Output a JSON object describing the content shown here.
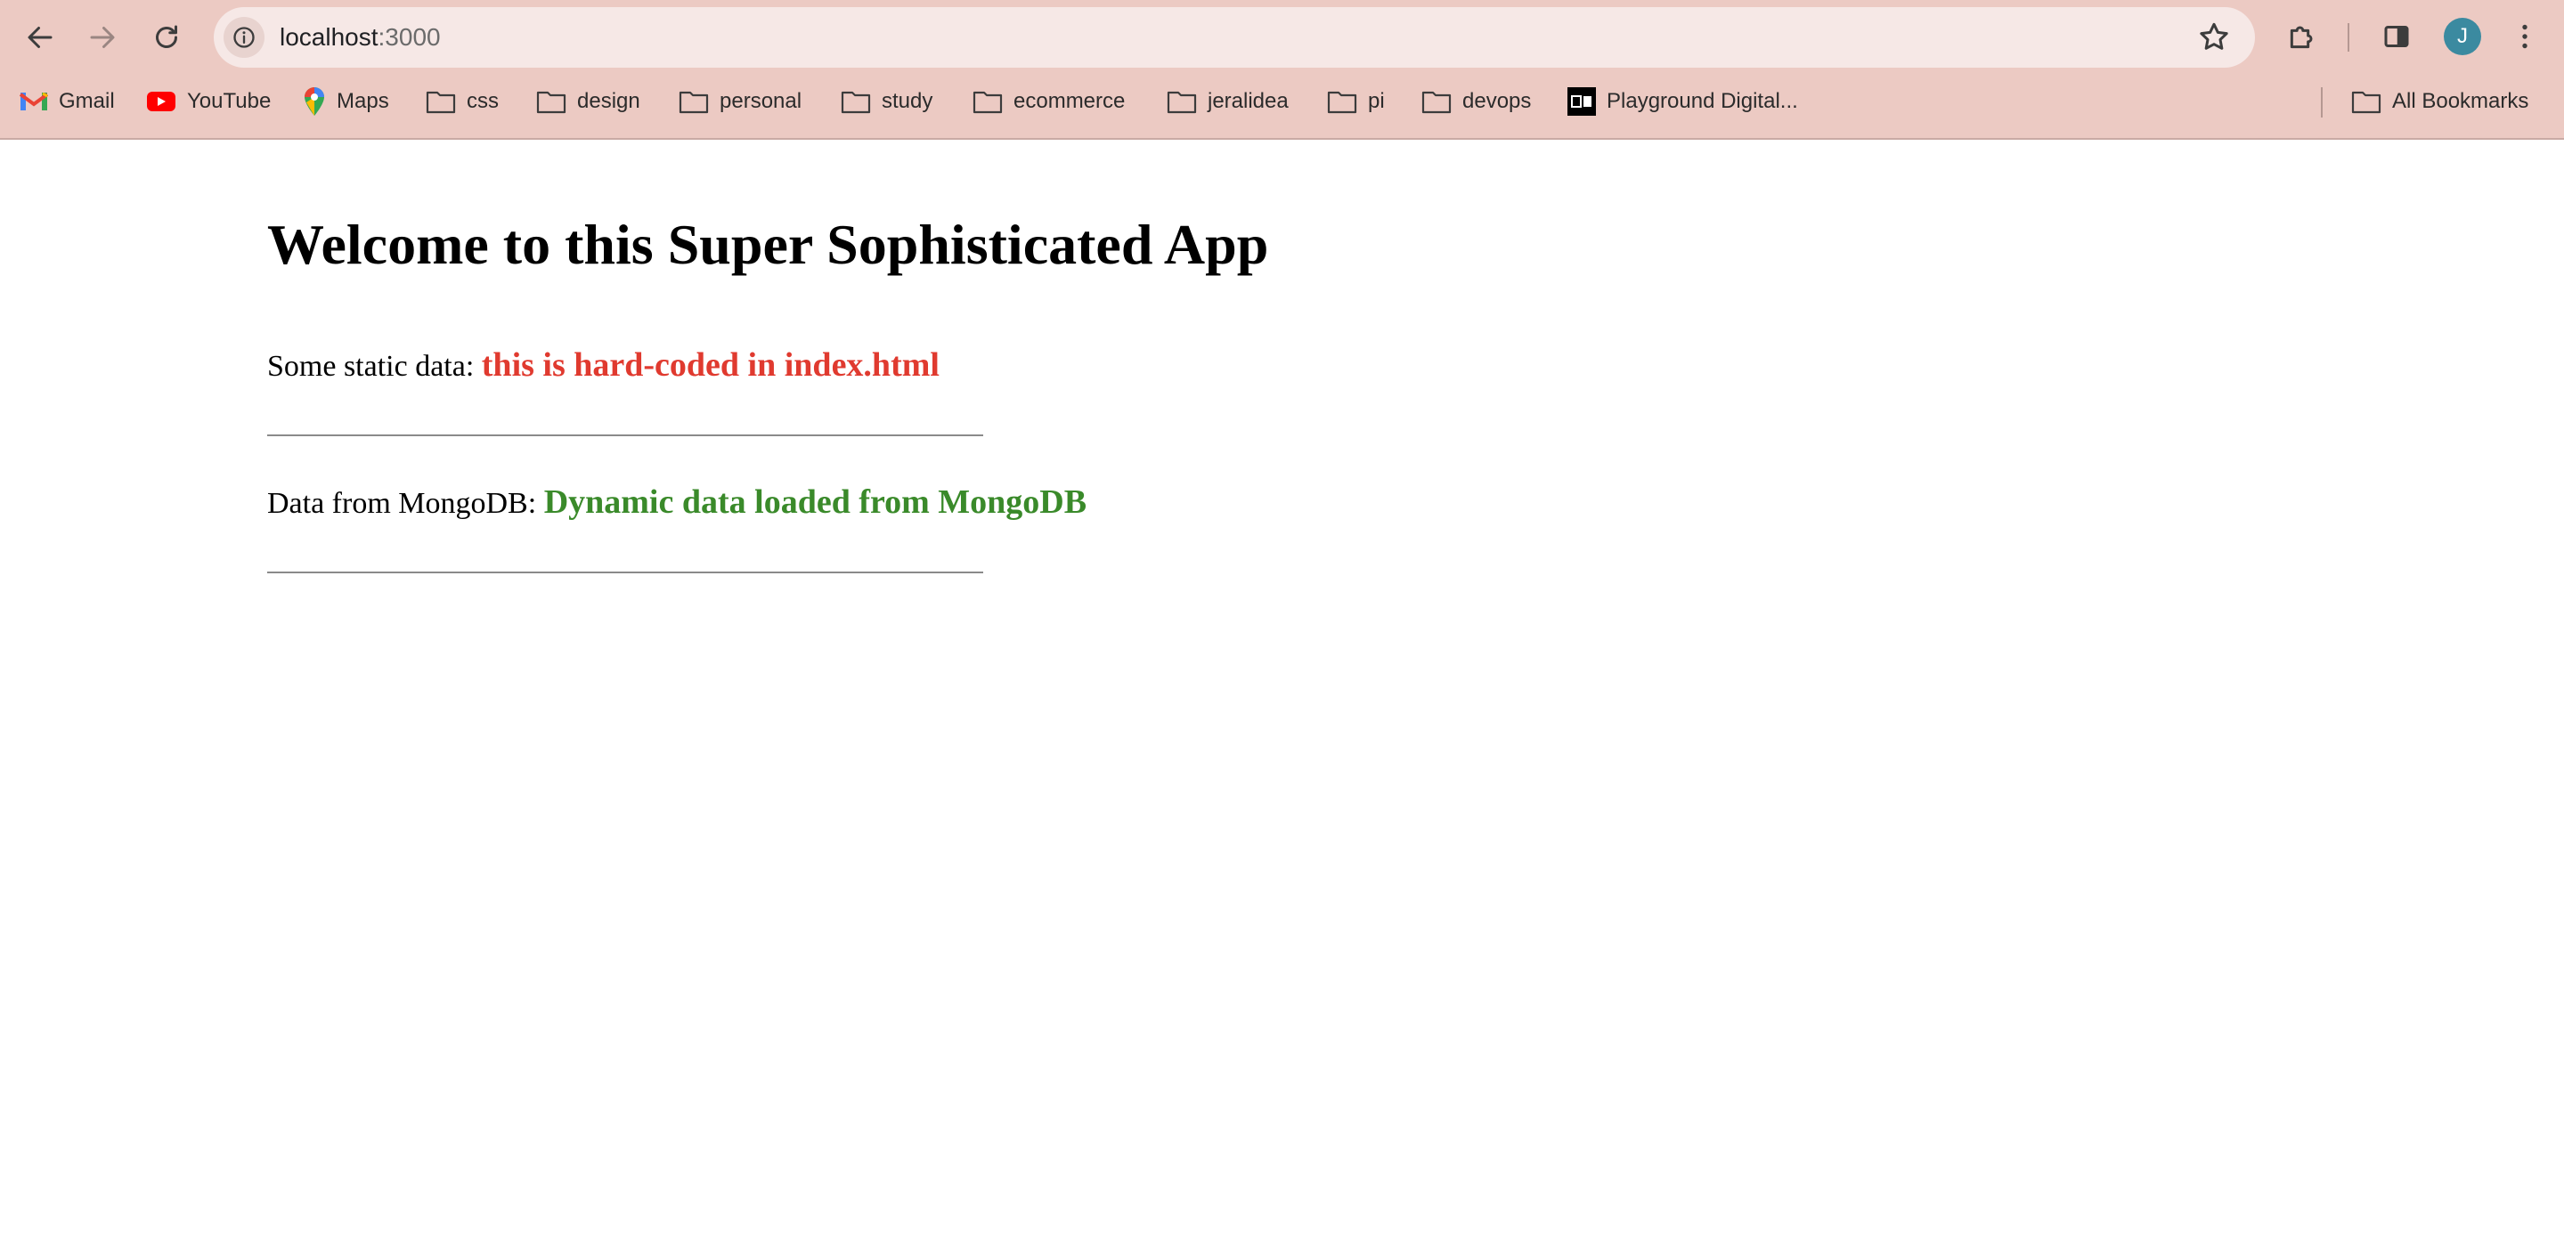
{
  "browser": {
    "url_host": "localhost",
    "url_port": ":3000",
    "avatar_initial": "J",
    "accent": "#eccac3",
    "bookmarks": [
      {
        "label": "Gmail",
        "icon": "gmail-icon"
      },
      {
        "label": "YouTube",
        "icon": "youtube-icon"
      },
      {
        "label": "Maps",
        "icon": "maps-icon"
      },
      {
        "label": "css",
        "icon": "folder-icon"
      },
      {
        "label": "design",
        "icon": "folder-icon"
      },
      {
        "label": "personal",
        "icon": "folder-icon"
      },
      {
        "label": "study",
        "icon": "folder-icon"
      },
      {
        "label": "ecommerce",
        "icon": "folder-icon"
      },
      {
        "label": "jeralidea",
        "icon": "folder-icon"
      },
      {
        "label": "pi",
        "icon": "folder-icon"
      },
      {
        "label": "devops",
        "icon": "folder-icon"
      },
      {
        "label": "Playground Digital...",
        "icon": "playground-digital-icon"
      }
    ],
    "all_bookmarks": "All Bookmarks"
  },
  "page": {
    "heading": "Welcome to this Super Sophisticated App",
    "static_label": "Some static data:",
    "static_value": "this is hard-coded in index.html",
    "static_color": "#e03a2f",
    "dynamic_label": "Data from MongoDB:",
    "dynamic_value": "Dynamic data loaded from MongoDB",
    "dynamic_color": "#3a8a2a"
  }
}
